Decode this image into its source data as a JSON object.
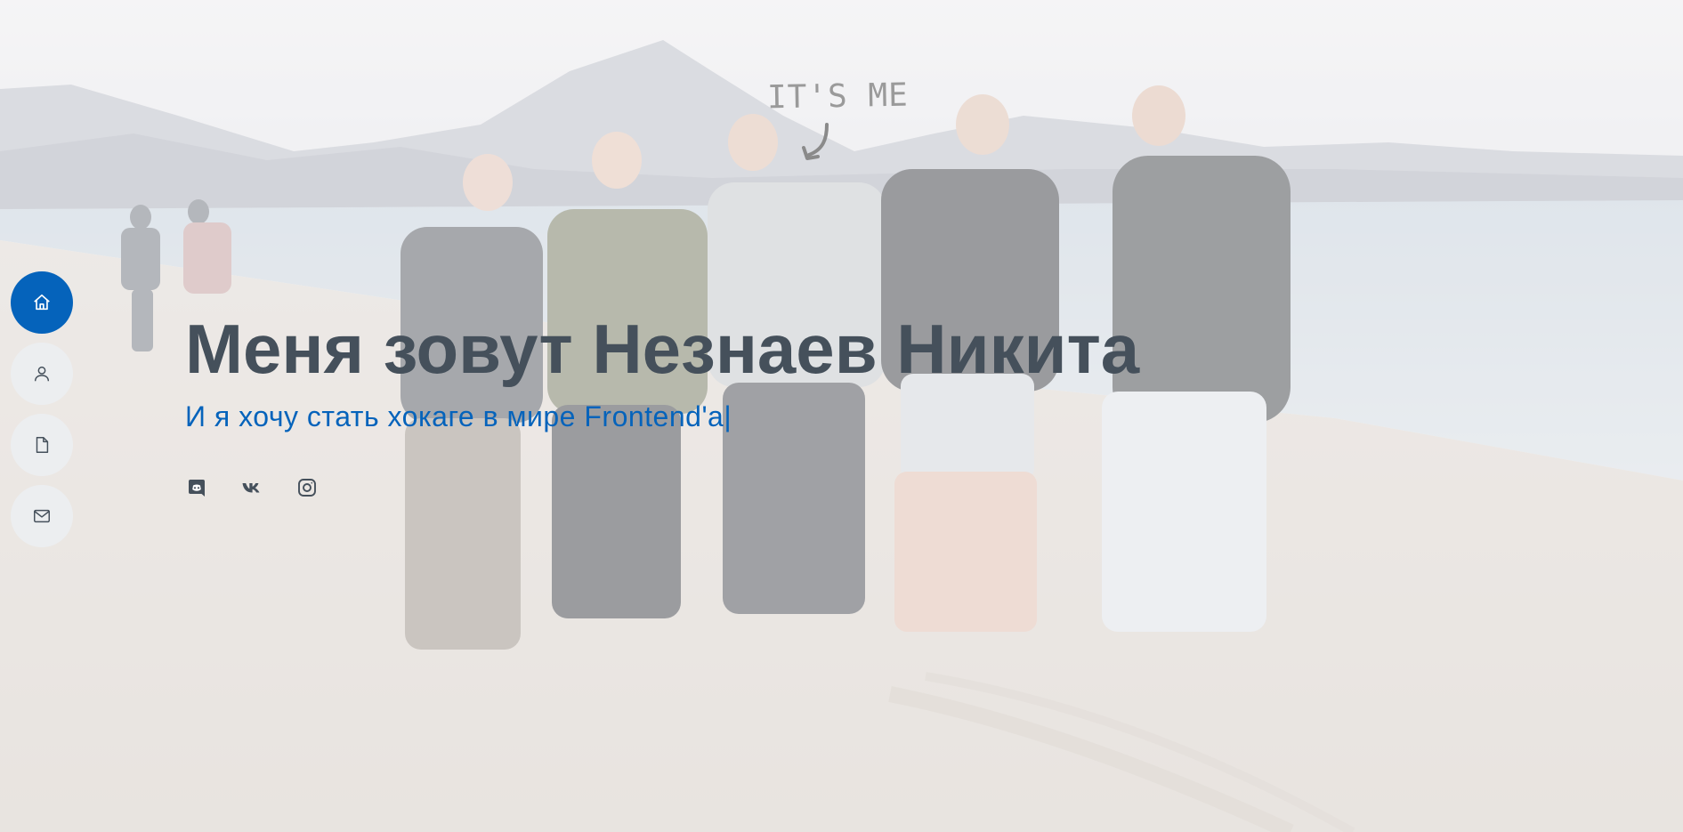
{
  "hero": {
    "annotation": "IT'S ME",
    "title": "Меня зовут Незнаев Никита",
    "subtitle": "И я хочу стать хокаге в мире Frontend'a",
    "cursor": "|"
  },
  "nav": {
    "items": [
      {
        "icon": "home-icon",
        "active": true
      },
      {
        "icon": "user-icon",
        "active": false
      },
      {
        "icon": "file-icon",
        "active": false
      },
      {
        "icon": "envelope-icon",
        "active": false
      }
    ]
  },
  "social": {
    "items": [
      {
        "icon": "discord-icon"
      },
      {
        "icon": "vk-icon"
      },
      {
        "icon": "instagram-icon"
      }
    ]
  },
  "colors": {
    "accent": "#0563bb",
    "title": "#45505b",
    "nav_bg": "#eceef0"
  }
}
